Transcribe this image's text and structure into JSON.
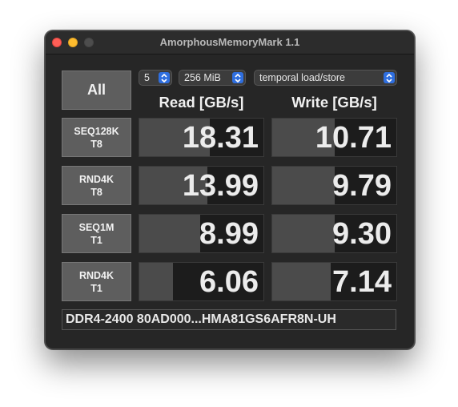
{
  "window": {
    "title": "AmorphousMemoryMark 1.1"
  },
  "controls": {
    "all_label": "All",
    "count": "5",
    "size": "256 MiB",
    "mode": "temporal load/store"
  },
  "columns": {
    "read": "Read [GB/s]",
    "write": "Write [GB/s]"
  },
  "rows": [
    {
      "line1": "SEQ128K",
      "line2": "T8",
      "read": "18.31",
      "write": "10.71",
      "read_fill": 0.57,
      "write_fill": 0.5
    },
    {
      "line1": "RND4K",
      "line2": "T8",
      "read": "13.99",
      "write": "9.79",
      "read_fill": 0.55,
      "write_fill": 0.5
    },
    {
      "line1": "SEQ1M",
      "line2": "T1",
      "read": "8.99",
      "write": "9.30",
      "read_fill": 0.49,
      "write_fill": 0.5
    },
    {
      "line1": "RND4K",
      "line2": "T1",
      "read": "6.06",
      "write": "7.14",
      "read_fill": 0.27,
      "write_fill": 0.47
    }
  ],
  "footer": {
    "device": "DDR4-2400 80AD000...HMA81GS6AFR8N-UH"
  },
  "colors": {
    "accent": "#2f6fe0",
    "bar": "#4b4b4b",
    "close": "#fe5f57",
    "minimize": "#febc2e"
  }
}
